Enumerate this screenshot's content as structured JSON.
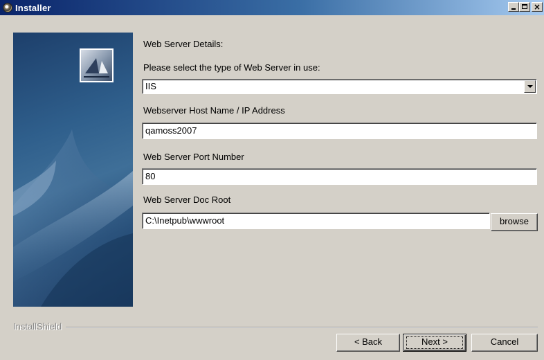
{
  "window": {
    "title": "Installer",
    "controls": {
      "minimize_icon": "minimize-icon",
      "maximize_icon": "maximize-icon",
      "close_icon": "close-icon",
      "close_glyph": "×"
    }
  },
  "form": {
    "heading": "Web Server Details:",
    "server_type_label": "Please select the type of Web Server in use:",
    "server_type_value": "IIS",
    "host_label": "Webserver Host Name / IP Address",
    "host_value": "qamoss2007",
    "port_label": "Web Server Port Number",
    "port_value": "80",
    "doc_root_label": "Web Server Doc Root",
    "doc_root_value": "C:\\Inetpub\\wwwroot",
    "browse_label": "browse"
  },
  "footer": {
    "brand": "InstallShield",
    "back_label": "< Back",
    "next_label": "Next >",
    "cancel_label": "Cancel"
  }
}
